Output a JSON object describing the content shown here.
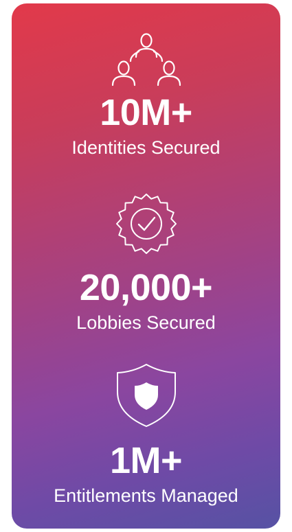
{
  "colors": {
    "gradient_top": "#e2394a",
    "gradient_mid": "#a24285",
    "gradient_bottom": "#5652a4",
    "text": "#ffffff"
  },
  "stats": [
    {
      "icon": "people-network-icon",
      "value": "10M+",
      "label": "Identities Secured"
    },
    {
      "icon": "verified-badge-check-icon",
      "value": "20,000+",
      "label": "Lobbies Secured"
    },
    {
      "icon": "shield-icon",
      "value": "1M+",
      "label": "Entitlements Managed"
    }
  ]
}
